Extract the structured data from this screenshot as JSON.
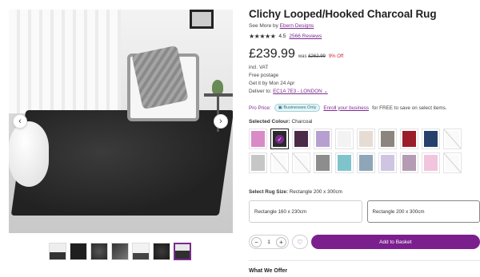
{
  "product": {
    "title": "Clichy Looped/Hooked Charcoal Rug",
    "see_more_prefix": "See More by",
    "brand": "Ebern Designs",
    "rating": "4.5",
    "reviews": "2566 Reviews",
    "price": "£239.99",
    "was_prefix": "was",
    "was_price": "£262.99",
    "discount": "9% Off"
  },
  "delivery": {
    "vat": "incl. VAT",
    "postage": "Free postage",
    "get_it": "Get it by Mon 24 Apr",
    "deliver_to_label": "Deliver to:",
    "deliver_to_value": "EC1A 7E3 - LONDON"
  },
  "pro": {
    "label": "Pro Price:",
    "badge": "Businesses Only",
    "link": "Enroll your business",
    "suffix": "for FREE to save on select items."
  },
  "colour": {
    "label": "Selected Colour:",
    "value": "Charcoal",
    "swatches": [
      {
        "name": "pink",
        "color": "#d98bc7"
      },
      {
        "name": "charcoal",
        "color": "#2a2a2a"
      },
      {
        "name": "plum",
        "color": "#4a2a46"
      },
      {
        "name": "lilac",
        "color": "#b7a0cf"
      },
      {
        "name": "white",
        "color": "#f3f3f3"
      },
      {
        "name": "beige",
        "color": "#e7dcd3"
      },
      {
        "name": "taupe",
        "color": "#8c847f"
      },
      {
        "name": "red",
        "color": "#9b1d2a"
      },
      {
        "name": "navy",
        "color": "#24406b"
      },
      {
        "name": "unavailable",
        "color": "#fafafa"
      },
      {
        "name": "light-grey",
        "color": "#c6c6c6"
      },
      {
        "name": "unavailable",
        "color": "#fafafa"
      },
      {
        "name": "unavailable",
        "color": "#fafafa"
      },
      {
        "name": "grey",
        "color": "#8d8d8d"
      },
      {
        "name": "turquoise",
        "color": "#7fc4cc"
      },
      {
        "name": "blue-grey",
        "color": "#8ea6b8"
      },
      {
        "name": "lavender",
        "color": "#cfc5e3"
      },
      {
        "name": "mauve",
        "color": "#b59bb3"
      },
      {
        "name": "light-pink",
        "color": "#f2c4de"
      },
      {
        "name": "unavailable",
        "color": "#fafafa"
      }
    ]
  },
  "size": {
    "label": "Select Rug Size:",
    "value": "Rectangle 200 x 300cm",
    "options": [
      "Rectangle 160 x 230cm",
      "Rectangle 200 x 300cm"
    ]
  },
  "cart": {
    "minus": "−",
    "qty": "1",
    "plus": "+",
    "add_label": "Add to Basket"
  },
  "offer": {
    "title": "What We Offer"
  },
  "gallery": {
    "prev": "‹",
    "next": "›"
  },
  "colors": {
    "accent": "#7b1f8f",
    "link": "#7b2a8f",
    "discount": "#c62828"
  }
}
